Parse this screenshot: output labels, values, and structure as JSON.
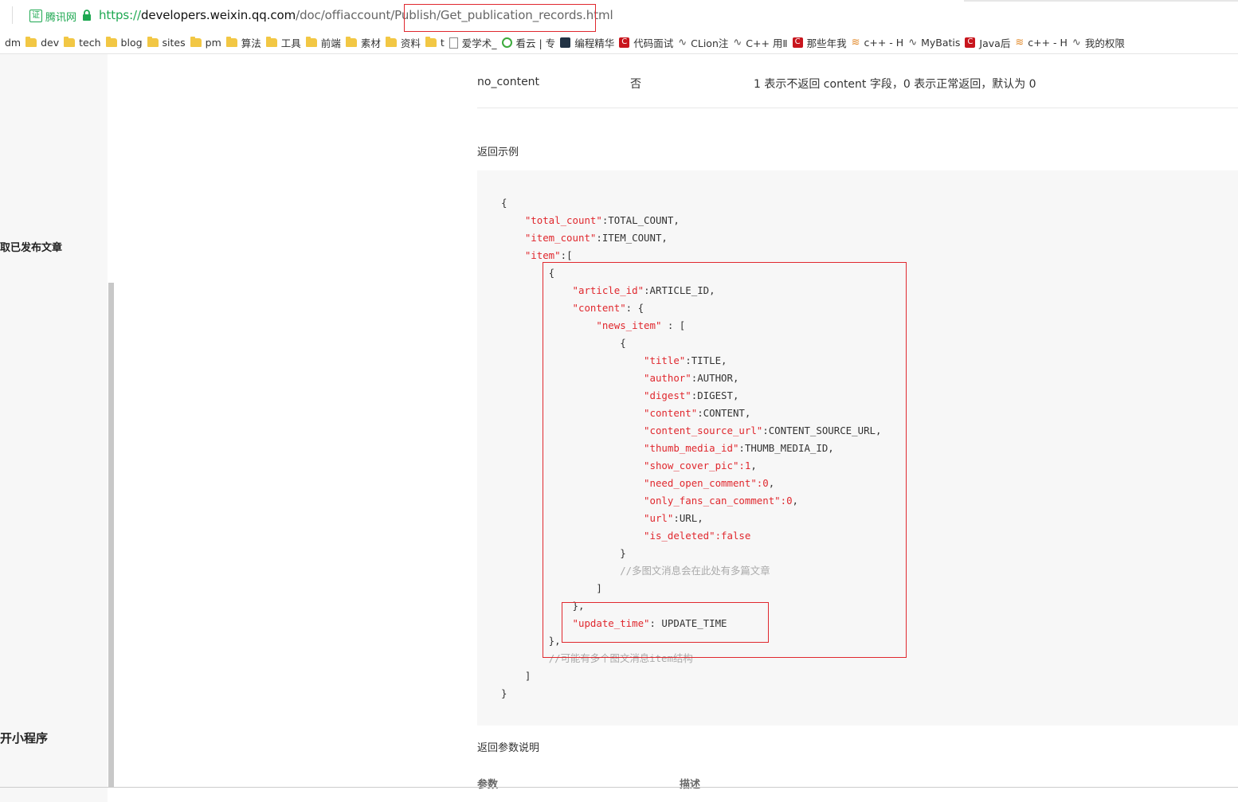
{
  "address_bar": {
    "cert_icon": "证",
    "cert_label": "腾讯网",
    "url_scheme": "https://",
    "url_host": "developers.weixin.qq.com",
    "url_path": "/doc/offiaccount/Publish/Get_publication_records.html"
  },
  "bookmarks": [
    {
      "label": "dm",
      "icon": "none"
    },
    {
      "label": "dev",
      "icon": "folder-icon"
    },
    {
      "label": "tech",
      "icon": "folder-icon"
    },
    {
      "label": "blog",
      "icon": "folder-icon"
    },
    {
      "label": "sites",
      "icon": "folder-icon"
    },
    {
      "label": "pm",
      "icon": "folder-icon"
    },
    {
      "label": "算法",
      "icon": "folder-icon"
    },
    {
      "label": "工具",
      "icon": "folder-icon"
    },
    {
      "label": "前端",
      "icon": "folder-icon"
    },
    {
      "label": "素材",
      "icon": "folder-icon"
    },
    {
      "label": "资料",
      "icon": "folder-icon"
    },
    {
      "label": "t",
      "icon": "folder-icon"
    },
    {
      "label": "爱学术_",
      "icon": "page-icon"
    },
    {
      "label": "看云 | 专",
      "icon": "green-icon"
    },
    {
      "label": "编程精华",
      "icon": "dark-icon"
    },
    {
      "label": "代码面试",
      "icon": "red-icon"
    },
    {
      "label": "CLion注",
      "icon": "glyph-icon"
    },
    {
      "label": "C++ 用Ⅱ",
      "icon": "glyph-icon"
    },
    {
      "label": "那些年我",
      "icon": "red-icon"
    },
    {
      "label": "c++ - H",
      "icon": "orange-icon"
    },
    {
      "label": "MyBatis",
      "icon": "glyph-icon"
    },
    {
      "label": "Java后",
      "icon": "red-icon"
    },
    {
      "label": "c++ - H",
      "icon": "orange-icon"
    },
    {
      "label": "我的权限",
      "icon": "glyph-icon"
    }
  ],
  "sidebar": {
    "item_published": "取已发布文章",
    "item_miniprogram": "开小程序"
  },
  "param_row": {
    "name": "no_content",
    "required": "否",
    "description": "1 表示不返回 content 字段，0 表示正常返回，默认为 0"
  },
  "example_heading": "返回示例",
  "code_lines": [
    [
      {
        "t": "{",
        "c": "p"
      }
    ],
    [
      {
        "t": "    ",
        "c": "p"
      },
      {
        "t": "\"total_count\"",
        "c": "k"
      },
      {
        "t": ":TOTAL_COUNT,",
        "c": "p"
      }
    ],
    [
      {
        "t": "    ",
        "c": "p"
      },
      {
        "t": "\"item_count\"",
        "c": "k"
      },
      {
        "t": ":ITEM_COUNT,",
        "c": "p"
      }
    ],
    [
      {
        "t": "    ",
        "c": "p"
      },
      {
        "t": "\"item\"",
        "c": "k"
      },
      {
        "t": ":[",
        "c": "p"
      }
    ],
    [
      {
        "t": "        {",
        "c": "p"
      }
    ],
    [
      {
        "t": "            ",
        "c": "p"
      },
      {
        "t": "\"article_id\"",
        "c": "k"
      },
      {
        "t": ":ARTICLE_ID,",
        "c": "p"
      }
    ],
    [
      {
        "t": "            ",
        "c": "p"
      },
      {
        "t": "\"content\"",
        "c": "k"
      },
      {
        "t": ": {",
        "c": "p"
      }
    ],
    [
      {
        "t": "                ",
        "c": "p"
      },
      {
        "t": "\"news_item\"",
        "c": "k"
      },
      {
        "t": " : [",
        "c": "p"
      }
    ],
    [
      {
        "t": "                    {",
        "c": "p"
      }
    ],
    [
      {
        "t": "                        ",
        "c": "p"
      },
      {
        "t": "\"title\"",
        "c": "k"
      },
      {
        "t": ":TITLE,",
        "c": "p"
      }
    ],
    [
      {
        "t": "                        ",
        "c": "p"
      },
      {
        "t": "\"author\"",
        "c": "k"
      },
      {
        "t": ":AUTHOR,",
        "c": "p"
      }
    ],
    [
      {
        "t": "                        ",
        "c": "p"
      },
      {
        "t": "\"digest\"",
        "c": "k"
      },
      {
        "t": ":DIGEST,",
        "c": "p"
      }
    ],
    [
      {
        "t": "                        ",
        "c": "p"
      },
      {
        "t": "\"content\"",
        "c": "k"
      },
      {
        "t": ":CONTENT,",
        "c": "p"
      }
    ],
    [
      {
        "t": "                        ",
        "c": "p"
      },
      {
        "t": "\"content_source_url\"",
        "c": "k"
      },
      {
        "t": ":CONTENT_SOURCE_URL,",
        "c": "p"
      }
    ],
    [
      {
        "t": "                        ",
        "c": "p"
      },
      {
        "t": "\"thumb_media_id\"",
        "c": "k"
      },
      {
        "t": ":THUMB_MEDIA_ID,",
        "c": "p"
      }
    ],
    [
      {
        "t": "                        ",
        "c": "p"
      },
      {
        "t": "\"show_cover_pic\"",
        "c": "k"
      },
      {
        "t": ":1",
        "c": "k"
      },
      {
        "t": ",",
        "c": "p"
      }
    ],
    [
      {
        "t": "                        ",
        "c": "p"
      },
      {
        "t": "\"need_open_comment\"",
        "c": "k"
      },
      {
        "t": ":0",
        "c": "k"
      },
      {
        "t": ",",
        "c": "p"
      }
    ],
    [
      {
        "t": "                        ",
        "c": "p"
      },
      {
        "t": "\"only_fans_can_comment\"",
        "c": "k"
      },
      {
        "t": ":0",
        "c": "k"
      },
      {
        "t": ",",
        "c": "p"
      }
    ],
    [
      {
        "t": "                        ",
        "c": "p"
      },
      {
        "t": "\"url\"",
        "c": "k"
      },
      {
        "t": ":URL,",
        "c": "p"
      }
    ],
    [
      {
        "t": "                        ",
        "c": "p"
      },
      {
        "t": "\"is_deleted\"",
        "c": "k"
      },
      {
        "t": ":false",
        "c": "k"
      }
    ],
    [
      {
        "t": "                    }",
        "c": "p"
      }
    ],
    [
      {
        "t": "                    ",
        "c": "p"
      },
      {
        "t": "//多图文消息会在此处有多篇文章",
        "c": "c"
      }
    ],
    [
      {
        "t": "                ]",
        "c": "p"
      }
    ],
    [
      {
        "t": "            },",
        "c": "p"
      }
    ],
    [
      {
        "t": "            ",
        "c": "p"
      },
      {
        "t": "\"update_time\"",
        "c": "k"
      },
      {
        "t": ": UPDATE_TIME",
        "c": "p"
      }
    ],
    [
      {
        "t": "        },",
        "c": "p"
      }
    ],
    [
      {
        "t": "        ",
        "c": "p"
      },
      {
        "t": "//可能有多个图文消息item结构",
        "c": "c"
      }
    ],
    [
      {
        "t": "    ]",
        "c": "p"
      }
    ],
    [
      {
        "t": "}",
        "c": "p"
      }
    ]
  ],
  "return_heading": "返回参数说明",
  "table_headers": {
    "param": "参数",
    "desc": "描述"
  },
  "colors": {
    "accent_red": "#e0282e",
    "secure_green": "#1ea851"
  }
}
